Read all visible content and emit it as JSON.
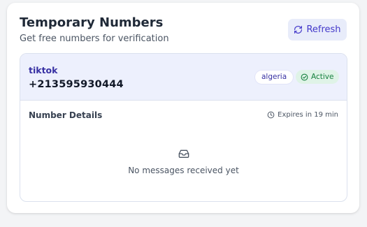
{
  "header": {
    "title": "Temporary Numbers",
    "subtitle": "Get free numbers for verification",
    "refresh_label": "Refresh",
    "refresh_icon": "refresh-icon"
  },
  "number": {
    "service": "tiktok",
    "phone": "+213595930444",
    "country": "algeria",
    "status": "Active",
    "status_icon": "check-circle-icon"
  },
  "details": {
    "title": "Number Details",
    "expires": "Expires in 19 min",
    "expires_icon": "clock-icon",
    "empty_icon": "inbox-icon",
    "empty_text": "No messages received yet"
  },
  "colors": {
    "accent": "#4338ca",
    "accent_bg": "#e8ecfa",
    "panel_head_bg": "#edf0fd",
    "active_bg": "#dff3e7",
    "active_text": "#15803d"
  }
}
